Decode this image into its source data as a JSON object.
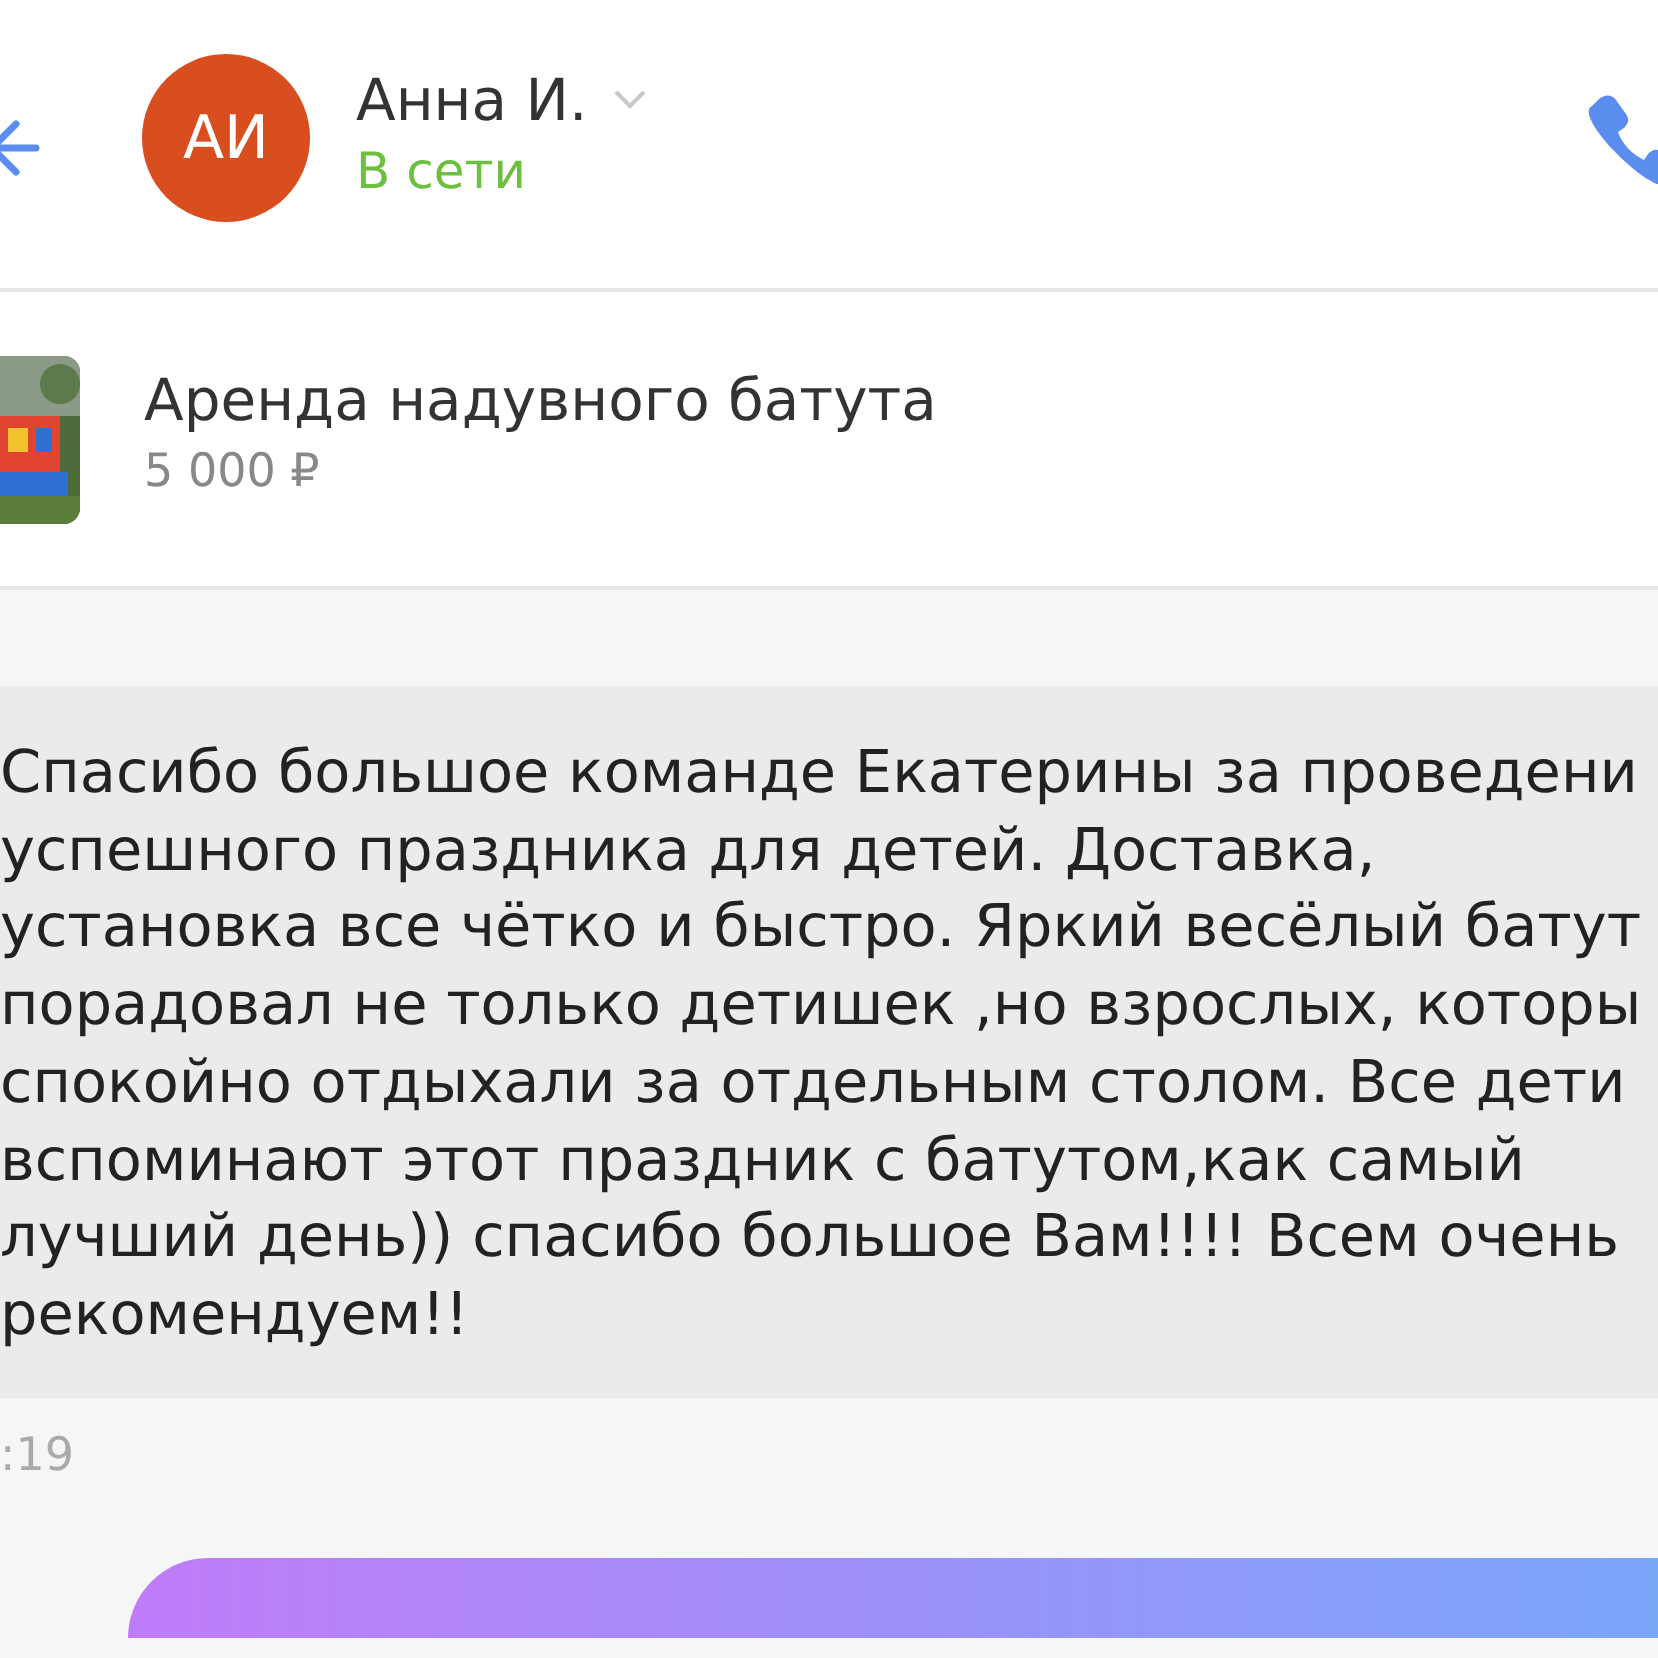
{
  "header": {
    "avatar_initials": "АИ",
    "name": "Анна И.",
    "status": "В сети"
  },
  "listing": {
    "title": "Аренда надувного батута",
    "price": "5 000 ₽"
  },
  "message": {
    "lines": [
      "Спасибо большое команде Екатерины за проведени",
      "успешного праздника для детей. Доставка,",
      "установка все чётко и быстро. Яркий весёлый батут",
      "порадовал не только детишек ,но взрослых, которы",
      "спокойно отдыхали за отдельным столом. Все дети",
      "вспоминают этот праздник с батутом,как самый",
      "лучший день)) спасибо большое Вам!!!! Всем очень",
      "рекомендуем!!"
    ],
    "time": ":19"
  }
}
